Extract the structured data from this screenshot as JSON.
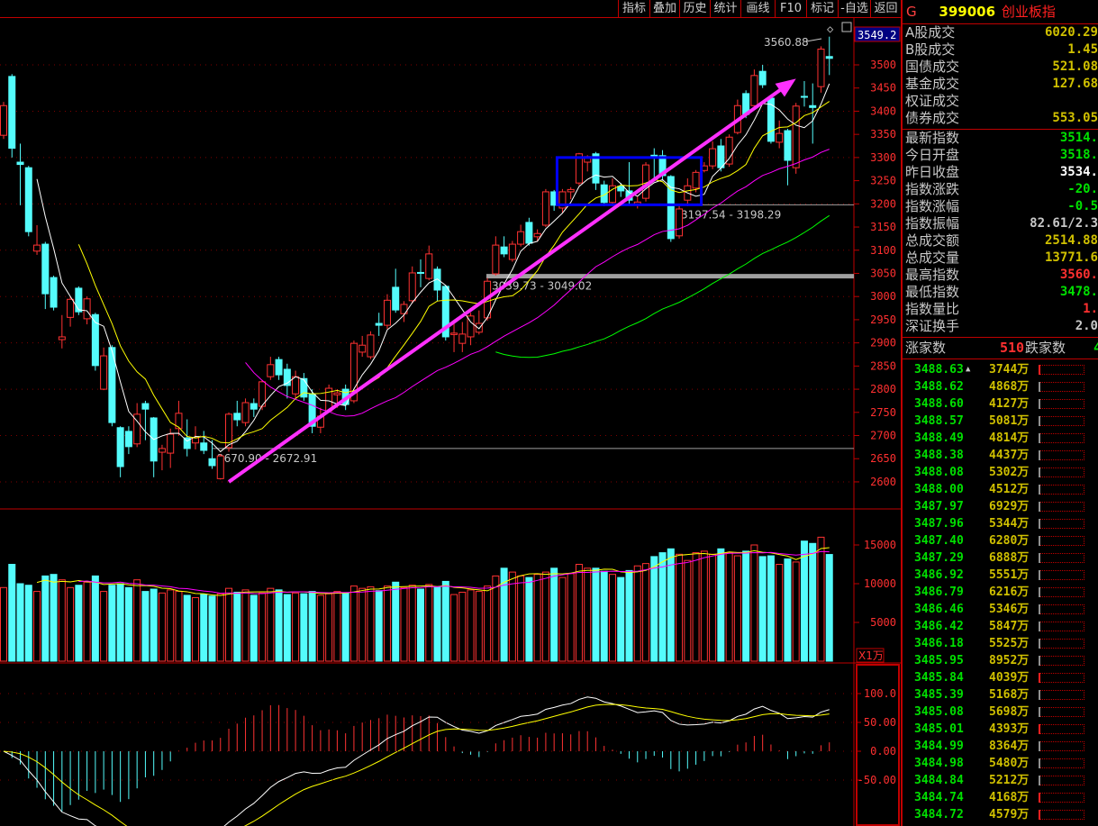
{
  "toolbar": {
    "items": [
      "指标",
      "叠加",
      "历史",
      "统计",
      "画线",
      "F10",
      "标记",
      "-自选",
      "返回"
    ]
  },
  "header": {
    "flag": "G",
    "code": "399006",
    "name": "创业板指"
  },
  "panel": {
    "group1": [
      {
        "label": "A股成交",
        "value": "6020.29",
        "color": "#d0c000"
      },
      {
        "label": "B股成交",
        "value": "1.45",
        "color": "#d0c000"
      },
      {
        "label": "国债成交",
        "value": "521.08",
        "color": "#d0c000"
      },
      {
        "label": "基金成交",
        "value": "127.68",
        "color": "#d0c000"
      },
      {
        "label": "权证成交",
        "value": "",
        "color": "#d0c000"
      },
      {
        "label": "债券成交",
        "value": "553.05",
        "color": "#d0c000"
      }
    ],
    "group2": [
      {
        "label": "最新指数",
        "value": "3514.",
        "color": "#00e000"
      },
      {
        "label": "今日开盘",
        "value": "3518.",
        "color": "#00e000"
      },
      {
        "label": "昨日收盘",
        "value": "3534.",
        "color": "#ffffff"
      },
      {
        "label": "指数涨跌",
        "value": "-20.",
        "color": "#00e000"
      },
      {
        "label": "指数涨幅",
        "value": "-0.5",
        "color": "#00e000"
      },
      {
        "label": "指数振幅",
        "value": "82.61/2.3",
        "color": "#c8c8c8"
      },
      {
        "label": "总成交额",
        "value": "2514.88",
        "color": "#d0c000"
      },
      {
        "label": "总成交量",
        "value": "13771.6",
        "color": "#d0c000"
      },
      {
        "label": "最高指数",
        "value": "3560.",
        "color": "#ff3030"
      },
      {
        "label": "最低指数",
        "value": "3478.",
        "color": "#00e000"
      },
      {
        "label": "指数量比",
        "value": "1.",
        "color": "#ff3030"
      },
      {
        "label": "深证换手",
        "value": "2.0",
        "color": "#c8c8c8"
      }
    ],
    "updown": {
      "up_label": "涨家数",
      "up_value": "510",
      "down_label": "跌家数",
      "down_value": "4"
    },
    "ticks": [
      [
        "3488.63",
        "3744万",
        "red"
      ],
      [
        "3488.62",
        "4868万",
        "gray"
      ],
      [
        "3488.60",
        "4127万",
        "gray"
      ],
      [
        "3488.57",
        "5081万",
        "gray"
      ],
      [
        "3488.49",
        "4814万",
        "gray"
      ],
      [
        "3488.38",
        "4437万",
        "gray"
      ],
      [
        "3488.08",
        "5302万",
        "gray"
      ],
      [
        "3488.00",
        "4512万",
        "gray"
      ],
      [
        "3487.97",
        "6929万",
        "gray"
      ],
      [
        "3487.96",
        "5344万",
        "gray"
      ],
      [
        "3487.40",
        "6280万",
        "gray"
      ],
      [
        "3487.29",
        "6888万",
        "gray"
      ],
      [
        "3486.92",
        "5551万",
        "gray"
      ],
      [
        "3486.79",
        "6216万",
        "gray"
      ],
      [
        "3486.46",
        "5346万",
        "gray"
      ],
      [
        "3486.42",
        "5847万",
        "gray"
      ],
      [
        "3486.18",
        "5525万",
        "gray"
      ],
      [
        "3485.95",
        "8952万",
        "gray"
      ],
      [
        "3485.84",
        "4039万",
        "red"
      ],
      [
        "3485.39",
        "5168万",
        "gray"
      ],
      [
        "3485.08",
        "5698万",
        "gray"
      ],
      [
        "3485.01",
        "4393万",
        "red"
      ],
      [
        "3484.99",
        "8364万",
        "gray"
      ],
      [
        "3484.98",
        "5480万",
        "gray"
      ],
      [
        "3484.84",
        "5212万",
        "gray"
      ],
      [
        "3484.74",
        "4168万",
        "red"
      ],
      [
        "3484.72",
        "4579万",
        "red"
      ]
    ]
  },
  "chart_data": {
    "type": "candlestick",
    "current_price_label": "3549.2",
    "high_label": "3560.88",
    "price_axis": {
      "ticks": [
        3500,
        3450,
        3400,
        3350,
        3300,
        3250,
        3200,
        3150,
        3100,
        3050,
        3000,
        2950,
        2900,
        2850,
        2800,
        2750,
        2700,
        2650,
        2600
      ],
      "ylim": [
        2580,
        3600
      ]
    },
    "candles": [
      [
        3348,
        3420,
        3340,
        3412
      ],
      [
        3475,
        3480,
        3300,
        3320
      ],
      [
        3290,
        3330,
        3197,
        3285
      ],
      [
        3278,
        3282,
        3130,
        3140
      ],
      [
        3098,
        3154,
        3090,
        3111
      ],
      [
        3113,
        3118,
        2973,
        3006
      ],
      [
        3041,
        3045,
        2970,
        2977
      ],
      [
        2907,
        2960,
        2888,
        2913
      ],
      [
        2955,
        3000,
        2935,
        2994
      ],
      [
        3018,
        3022,
        2960,
        2967
      ],
      [
        2952,
        3000,
        2940,
        2995
      ],
      [
        2961,
        2965,
        2840,
        2851
      ],
      [
        2800,
        2890,
        2798,
        2872
      ],
      [
        2890,
        2895,
        2720,
        2728
      ],
      [
        2717,
        2720,
        2610,
        2633
      ],
      [
        2709,
        2720,
        2660,
        2676
      ],
      [
        2682,
        2770,
        2675,
        2746
      ],
      [
        2769,
        2775,
        2690,
        2757
      ],
      [
        2738,
        2740,
        2610,
        2645
      ],
      [
        2664,
        2680,
        2625,
        2672
      ],
      [
        2662,
        2715,
        2630,
        2703
      ],
      [
        2715,
        2775,
        2700,
        2748
      ],
      [
        2695,
        2735,
        2655,
        2672
      ],
      [
        2684,
        2720,
        2670,
        2695
      ],
      [
        2684,
        2710,
        2660,
        2668
      ],
      [
        2650,
        2690,
        2628,
        2635
      ],
      [
        2607,
        2660,
        2605,
        2656
      ],
      [
        2674,
        2750,
        2665,
        2746
      ],
      [
        2748,
        2775,
        2720,
        2734
      ],
      [
        2728,
        2780,
        2720,
        2771
      ],
      [
        2769,
        2780,
        2740,
        2757
      ],
      [
        2763,
        2820,
        2755,
        2816
      ],
      [
        2827,
        2870,
        2820,
        2853
      ],
      [
        2864,
        2870,
        2820,
        2831
      ],
      [
        2843,
        2855,
        2780,
        2808
      ],
      [
        2790,
        2840,
        2780,
        2827
      ],
      [
        2823,
        2835,
        2775,
        2783
      ],
      [
        2790,
        2800,
        2705,
        2720
      ],
      [
        2718,
        2760,
        2705,
        2742
      ],
      [
        2753,
        2810,
        2750,
        2802
      ],
      [
        2788,
        2800,
        2760,
        2792
      ],
      [
        2800,
        2810,
        2755,
        2767
      ],
      [
        2775,
        2905,
        2770,
        2899
      ],
      [
        2880,
        2915,
        2870,
        2895
      ],
      [
        2870,
        2925,
        2865,
        2917
      ],
      [
        2942,
        2965,
        2915,
        2938
      ],
      [
        2938,
        3005,
        2930,
        2992
      ],
      [
        3020,
        3060,
        2965,
        2971
      ],
      [
        2963,
        2990,
        2945,
        2983
      ],
      [
        2991,
        3065,
        2985,
        3051
      ],
      [
        3052,
        3080,
        3020,
        3050
      ],
      [
        3039,
        3110,
        3035,
        3092
      ],
      [
        3059,
        3065,
        2990,
        3014
      ],
      [
        3022,
        3025,
        2905,
        2913
      ],
      [
        2918,
        2945,
        2880,
        2921
      ],
      [
        2899,
        2945,
        2880,
        2919
      ],
      [
        2913,
        2965,
        2895,
        2958
      ],
      [
        2923,
        2970,
        2918,
        2942
      ],
      [
        2954,
        3040,
        2948,
        3033
      ],
      [
        3049,
        3130,
        3045,
        3111
      ],
      [
        3107,
        3130,
        3085,
        3092
      ],
      [
        3080,
        3120,
        3075,
        3113
      ],
      [
        3113,
        3155,
        3108,
        3140
      ],
      [
        3160,
        3170,
        3110,
        3115
      ],
      [
        3129,
        3145,
        3120,
        3136
      ],
      [
        3154,
        3232,
        3150,
        3226
      ],
      [
        3226,
        3230,
        3185,
        3197
      ],
      [
        3191,
        3232,
        3180,
        3226
      ],
      [
        3226,
        3236,
        3210,
        3231
      ],
      [
        3245,
        3310,
        3240,
        3308
      ],
      [
        3290,
        3305,
        3270,
        3302
      ],
      [
        3308,
        3312,
        3230,
        3245
      ],
      [
        3241,
        3250,
        3195,
        3203
      ],
      [
        3203,
        3255,
        3195,
        3239
      ],
      [
        3238,
        3245,
        3215,
        3228
      ],
      [
        3228,
        3290,
        3198,
        3208
      ],
      [
        3200,
        3215,
        3190,
        3204
      ],
      [
        3212,
        3290,
        3205,
        3284
      ],
      [
        3305,
        3320,
        3250,
        3304
      ],
      [
        3304,
        3316,
        3250,
        3261
      ],
      [
        3259,
        3262,
        3118,
        3125
      ],
      [
        3131,
        3195,
        3125,
        3189
      ],
      [
        3208,
        3255,
        3195,
        3239
      ],
      [
        3234,
        3273,
        3225,
        3268
      ],
      [
        3272,
        3290,
        3268,
        3282
      ],
      [
        3282,
        3335,
        3275,
        3319
      ],
      [
        3325,
        3340,
        3270,
        3278
      ],
      [
        3286,
        3350,
        3280,
        3344
      ],
      [
        3354,
        3425,
        3350,
        3412
      ],
      [
        3438,
        3445,
        3385,
        3393
      ],
      [
        3412,
        3490,
        3405,
        3477
      ],
      [
        3486,
        3500,
        3450,
        3457
      ],
      [
        3428,
        3432,
        3330,
        3335
      ],
      [
        3333,
        3380,
        3320,
        3352
      ],
      [
        3358,
        3362,
        3240,
        3294
      ],
      [
        3278,
        3418,
        3265,
        3411
      ],
      [
        3432,
        3465,
        3410,
        3430
      ],
      [
        3412,
        3460,
        3330,
        3408
      ],
      [
        3453,
        3540,
        3440,
        3534
      ],
      [
        3518,
        3560.88,
        3478,
        3514
      ]
    ],
    "ma_lines": [
      {
        "period": 5,
        "color": "#ffffff"
      },
      {
        "period": 10,
        "color": "#ffff00"
      },
      {
        "period": 30,
        "color": "#ff00ff"
      },
      {
        "period": 60,
        "color": "#00ff00"
      }
    ],
    "annotations": [
      {
        "text": "3197.54 - 3198.29",
        "price": 3198
      },
      {
        "text": "3039.73 - 3049.02",
        "price": 3044
      },
      {
        "text": "2670.90 - 2672.91",
        "price": 2672
      }
    ],
    "box": {
      "from_index": 67,
      "to_index": 83,
      "price_top": 3300,
      "price_bottom": 3198,
      "color": "#0000ff"
    },
    "arrow": {
      "from_index": 27,
      "from_price": 2600,
      "to_index": 95,
      "to_price": 3470,
      "color": "#ff30ff"
    },
    "volume": {
      "unit_label": "X1万",
      "ticks": [
        15000,
        10000,
        5000
      ],
      "values": [
        9500,
        12500,
        10000,
        9800,
        9000,
        11000,
        11200,
        10500,
        9500,
        9800,
        10200,
        11000,
        9000,
        9800,
        10000,
        9500,
        10500,
        9000,
        9300,
        8800,
        9200,
        9000,
        8500,
        8200,
        8600,
        8400,
        8700,
        9400,
        8900,
        9200,
        8500,
        8800,
        9400,
        9200,
        8600,
        8800,
        8700,
        9000,
        8500,
        8700,
        9000,
        8800,
        9700,
        9400,
        9600,
        9100,
        9700,
        10200,
        9500,
        9800,
        9300,
        9900,
        9600,
        10300,
        8600,
        8900,
        9200,
        9000,
        9700,
        11000,
        12000,
        11500,
        11000,
        10800,
        11200,
        11500,
        12000,
        10800,
        11300,
        12500,
        12000,
        12000,
        11600,
        11200,
        10800,
        11700,
        12300,
        12600,
        13500,
        14000,
        14500,
        13800,
        13000,
        14000,
        14200,
        13800,
        14500,
        14000,
        13600,
        14200,
        15000,
        13500,
        13600,
        12500,
        13200,
        12800,
        15500,
        15200,
        16000,
        13771.6
      ]
    },
    "macd": {
      "ticks": [
        "100.0",
        "50.00",
        "0.00",
        "-50.00"
      ],
      "tick_values": [
        100,
        50,
        0,
        -50
      ]
    }
  }
}
